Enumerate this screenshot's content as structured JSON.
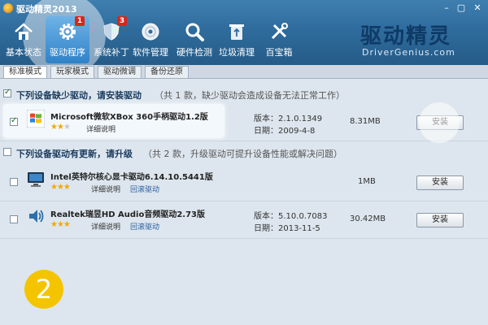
{
  "window": {
    "title": "驱动精灵2013",
    "min": "–",
    "max": "▢",
    "close": "✕"
  },
  "toolbar": [
    {
      "label": "基本状态",
      "icon": "home-icon",
      "badge": ""
    },
    {
      "label": "驱动程序",
      "icon": "gear-icon",
      "badge": "1",
      "active": true
    },
    {
      "label": "系统补丁",
      "icon": "shield-icon",
      "badge": "3"
    },
    {
      "label": "软件管理",
      "icon": "disc-icon",
      "badge": ""
    },
    {
      "label": "硬件检测",
      "icon": "magnifier-icon",
      "badge": ""
    },
    {
      "label": "垃圾清理",
      "icon": "recycle-bin-icon",
      "badge": ""
    },
    {
      "label": "百宝箱",
      "icon": "tools-icon",
      "badge": ""
    }
  ],
  "brand": {
    "logo": "驱动精灵",
    "url": "DriverGenius.com"
  },
  "mode_tabs": [
    "标准模式",
    "玩家模式",
    "驱动微调",
    "备份还原"
  ],
  "section_missing": {
    "title": "下列设备缺少驱动，请安装驱动",
    "note": "（共 1 款，缺少驱动会造成设备无法正常工作）"
  },
  "section_update": {
    "title": "下列设备驱动有更新，请升级",
    "note": "（共 2 款，升级驱动可提升设备性能或解决问题）"
  },
  "rows": [
    {
      "name": "Microsoft微软XBox 360手柄驱动1.2版",
      "stars_on": "★★",
      "stars_off": "★",
      "link1": "详细说明",
      "link2": "",
      "version": "版本：2.1.0.1349",
      "date": "日期：2009-4-8",
      "size": "8.31MB",
      "button": "安装"
    },
    {
      "name": "Intel英特尔核心显卡驱动6.14.10.5441版",
      "stars_on": "★★★",
      "stars_off": "",
      "link1": "详细说明",
      "link2": "回滚驱动",
      "version": "",
      "date": "",
      "size": "1MB",
      "button": "安装"
    },
    {
      "name": "Realtek瑞昱HD Audio音频驱动2.73版",
      "stars_on": "★★★",
      "stars_off": "",
      "link1": "详细说明",
      "link2": "回滚驱动",
      "version": "版本：5.10.0.7083",
      "date": "日期：2013-11-5",
      "size": "30.42MB",
      "button": "安装"
    }
  ],
  "step": "2",
  "colors": {
    "titlebar": "#2f6c9d",
    "active_tool": "#2f82c9",
    "badge": "#d9261c",
    "step": "#f5c400"
  }
}
